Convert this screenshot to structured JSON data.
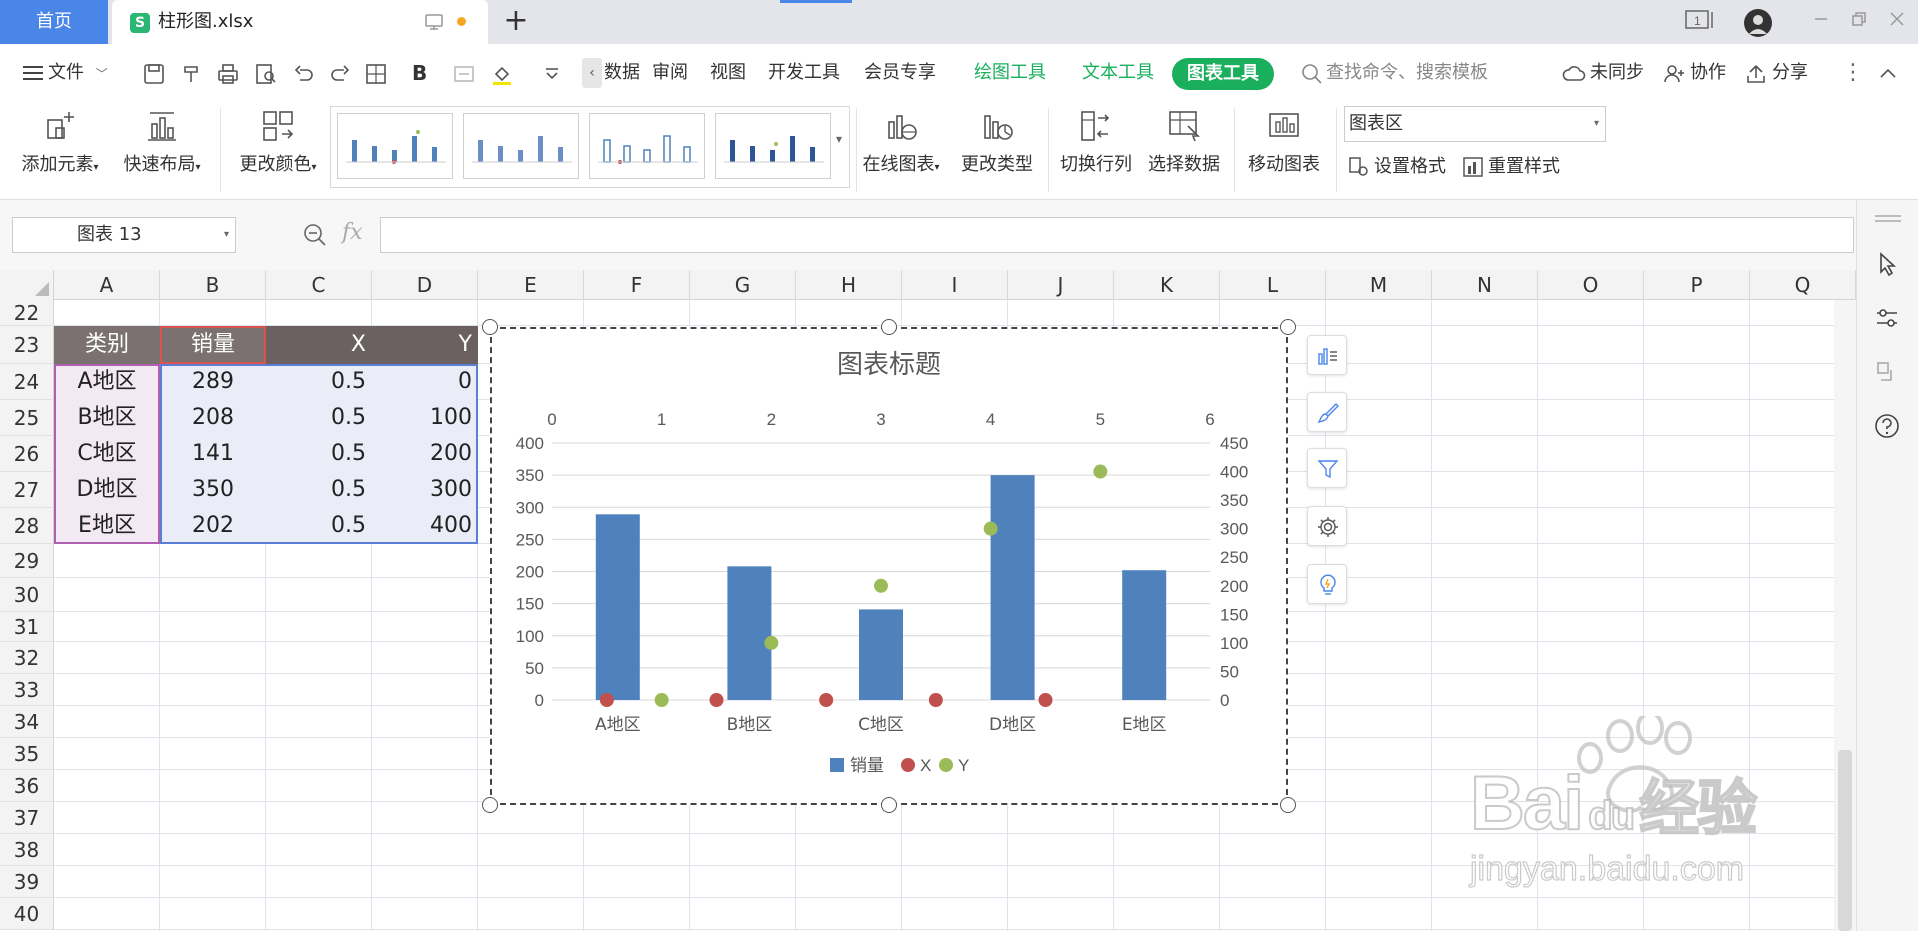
{
  "titlebar": {
    "home_tab": "首页",
    "file_tab_title": "柱形图.xlsx",
    "new_tab": "+",
    "page_indicator": "1"
  },
  "menubar": {
    "file_menu": "文件",
    "items": [
      "数据",
      "审阅",
      "视图",
      "开发工具",
      "会员专享"
    ],
    "drawing_tools": "绘图工具",
    "text_tools": "文本工具",
    "chart_tools": "图表工具",
    "search_placeholder": "查找命令、搜索模板",
    "unsync": "未同步",
    "collaborate": "协作",
    "share": "分享"
  },
  "ribbon": {
    "add_element": "添加元素",
    "quick_layout": "快速布局",
    "change_color": "更改颜色",
    "online_chart": "在线图表",
    "change_type": "更改类型",
    "switch_row_col": "切换行列",
    "select_data": "选择数据",
    "move_chart": "移动图表",
    "chart_area_select": "图表区",
    "set_format": "设置格式",
    "reset_style": "重置样式"
  },
  "formula": {
    "name_box": "图表 13",
    "fx": "fx",
    "content": ""
  },
  "grid": {
    "columns": [
      "A",
      "B",
      "C",
      "D",
      "E",
      "F",
      "G",
      "H",
      "I",
      "J",
      "K",
      "L",
      "M",
      "N",
      "O",
      "P",
      "Q"
    ],
    "rows": [
      "22",
      "23",
      "24",
      "25",
      "26",
      "27",
      "28",
      "29",
      "30",
      "31",
      "32",
      "33",
      "34",
      "35",
      "36",
      "37",
      "38",
      "39",
      "40"
    ],
    "table_headers": [
      "类别",
      "销量",
      "X",
      "Y"
    ],
    "table_rows": [
      [
        "A地区",
        "289",
        "0.5",
        "0"
      ],
      [
        "B地区",
        "208",
        "0.5",
        "100"
      ],
      [
        "C地区",
        "141",
        "0.5",
        "200"
      ],
      [
        "D地区",
        "350",
        "0.5",
        "300"
      ],
      [
        "E地区",
        "202",
        "0.5",
        "400"
      ]
    ]
  },
  "colors": {
    "bar": "#4f81bd",
    "scatter_x": "#c0504d",
    "scatter_y": "#9bbb59",
    "chart_tools_green": "#1aaf5d",
    "home_blue": "#4a86e8"
  },
  "chart_data": {
    "type": "bar",
    "title": "图表标题",
    "categories": [
      "A地区",
      "B地区",
      "C地区",
      "D地区",
      "E地区"
    ],
    "series": [
      {
        "name": "销量",
        "type": "bar",
        "values": [
          289,
          208,
          141,
          350,
          202
        ],
        "axis": "primary"
      }
    ],
    "scatter_series": [
      {
        "name": "X",
        "type": "scatter",
        "points": [
          [
            0.5,
            0
          ],
          [
            1.5,
            0
          ],
          [
            2.5,
            0
          ],
          [
            3.5,
            0
          ],
          [
            4.5,
            0
          ]
        ],
        "axis": "secondary"
      },
      {
        "name": "Y",
        "type": "scatter",
        "points": [
          [
            1,
            0
          ],
          [
            2,
            100
          ],
          [
            3,
            200
          ],
          [
            4,
            300
          ],
          [
            5,
            400
          ]
        ],
        "axis": "secondary"
      }
    ],
    "y_primary": {
      "min": 0,
      "max": 400,
      "ticks": [
        0,
        50,
        100,
        150,
        200,
        250,
        300,
        350,
        400
      ]
    },
    "y_secondary": {
      "min": 0,
      "max": 450,
      "ticks": [
        0,
        50,
        100,
        150,
        200,
        250,
        300,
        350,
        400,
        450
      ]
    },
    "x_secondary": {
      "min": 0,
      "max": 6,
      "ticks": [
        0,
        1,
        2,
        3,
        4,
        5,
        6
      ]
    },
    "legend": {
      "position": "bottom",
      "entries": [
        "销量",
        "X",
        "Y"
      ]
    },
    "grid": true
  },
  "watermark": {
    "text1": "Bai",
    "text2": "du",
    "text3": "经验",
    "url": "jingyan.baidu.com"
  }
}
